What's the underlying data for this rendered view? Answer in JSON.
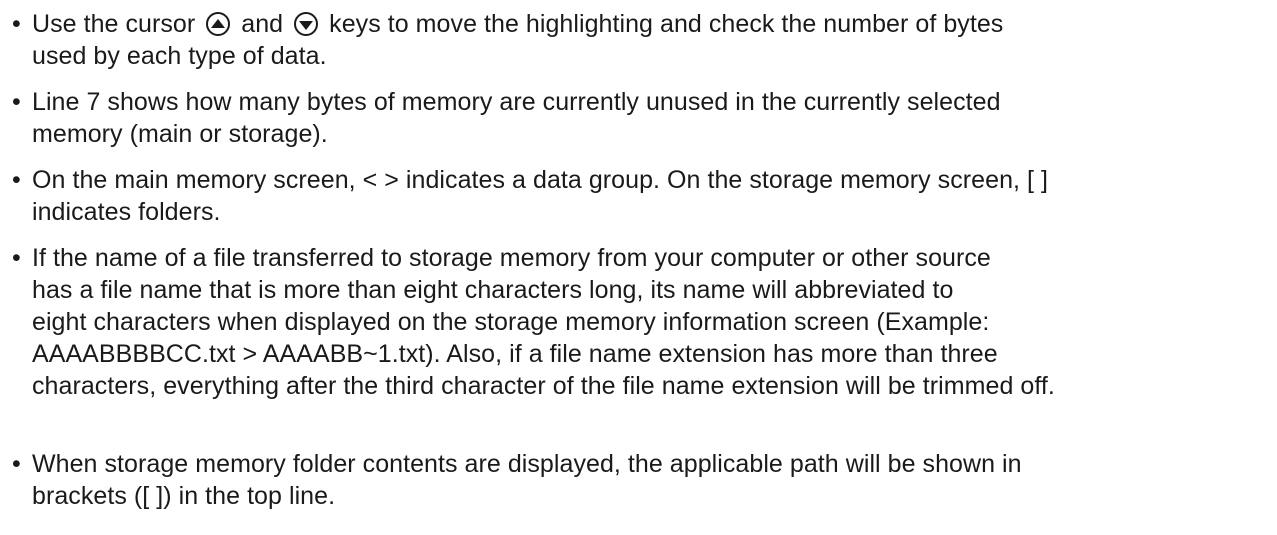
{
  "bullet_symbol": "•",
  "icons": {
    "up": "cursor-up-key-icon",
    "down": "cursor-down-key-icon"
  },
  "items": [
    {
      "line1": {
        "a": "Use the cursor",
        "b": "and",
        "c": "keys to move the highlighting and check the number of bytes"
      },
      "line2": "used by each type of data."
    },
    {
      "line1": "Line 7 shows how many bytes of memory are currently unused in the currently selected",
      "line2": "memory (main or storage)."
    },
    {
      "line1": "On the main memory screen, < > indicates a data group. On the storage memory screen, [ ]",
      "line2": "indicates folders."
    },
    {
      "line1": "If the name of a file transferred to storage memory from your computer or other source",
      "line2": "has a file name that is more than eight characters long, its name will abbreviated to",
      "line3": "eight characters when displayed on the storage memory information screen (Example:",
      "line4": "AAAABBBBCC.txt > AAAABB~1.txt). Also, if a file name extension has more than three",
      "line5": "characters, everything after the third character of the file name extension will be trimmed off."
    },
    {
      "line1": "When storage memory folder contents are displayed, the applicable path will be shown in",
      "line2": "brackets ([ ]) in the top line."
    }
  ]
}
